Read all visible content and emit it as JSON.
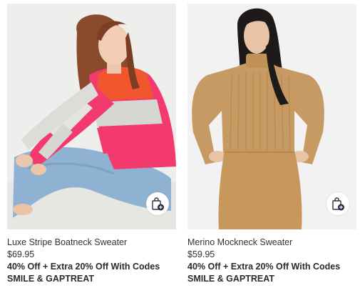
{
  "products": [
    {
      "name": "Luxe Stripe Boatneck Sweater",
      "price": "$69.95",
      "promo_line1": "40% Off + Extra 20% Off With Codes",
      "promo_line2": "SMILE & GAPTREAT",
      "icon": "shopping-bag-add-icon",
      "image": "product-photo"
    },
    {
      "name": "Merino Mockneck Sweater",
      "price": "$59.95",
      "promo_line1": "40% Off + Extra 20% Off With Codes",
      "promo_line2": "SMILE & GAPTREAT",
      "icon": "shopping-bag-add-icon",
      "image": "product-photo"
    }
  ],
  "colors": {
    "text": "#2b2b2b",
    "photo_bg_left": "#eeeeec",
    "photo_bg_right": "#f2f2f2",
    "sweater_pink": "#f23a6e",
    "sweater_orange": "#f2562f",
    "sweater_grey": "#d6d6d3",
    "sweater_camel": "#c69a62",
    "denim": "#8fb2d2"
  }
}
